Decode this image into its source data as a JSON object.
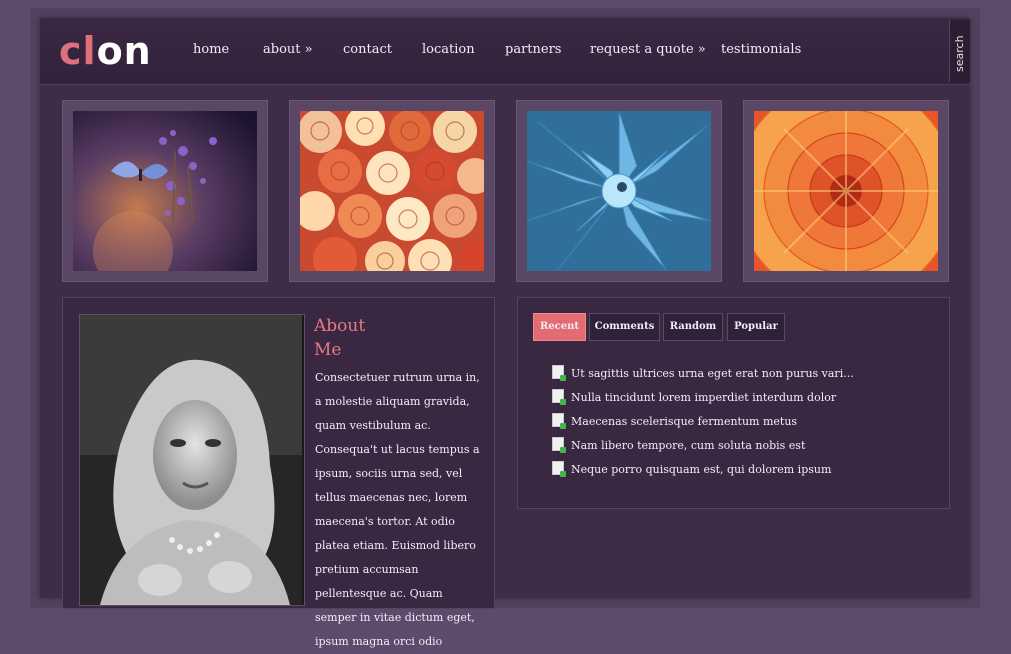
{
  "logo": {
    "part1": "cl",
    "part2": "on"
  },
  "nav": {
    "items": [
      {
        "label": "home"
      },
      {
        "label": "about »"
      },
      {
        "label": "contact"
      },
      {
        "label": "location"
      },
      {
        "label": "partners"
      },
      {
        "label": "request a quote »"
      },
      {
        "label": "testimonials"
      }
    ],
    "search": "search"
  },
  "gallery": [
    {
      "name": "butterfly-lavender"
    },
    {
      "name": "roses"
    },
    {
      "name": "blue-agave"
    },
    {
      "name": "orange-dahlia"
    }
  ],
  "about": {
    "title_line1": "About",
    "title_line2": "Me",
    "text": "Consectetuer rutrum urna in, a molestie aliquam gravida, quam vestibulum ac. Consequa't ut lacus tempus a ipsum, sociis urna sed, vel tellus maecenas nec, lorem maecena's tortor. At odio platea etiam. Euismod libero pretium accumsan pellentesque ac. Quam semper in vitae dictum eget, ipsum magna orci odio"
  },
  "tabs": [
    {
      "label": "Recent"
    },
    {
      "label": "Comments"
    },
    {
      "label": "Random"
    },
    {
      "label": "Popular"
    }
  ],
  "posts": [
    {
      "title": "Ut sagittis ultrices urna eget erat non purus vari..."
    },
    {
      "title": "Nulla tincidunt lorem imperdiet interdum dolor"
    },
    {
      "title": "Maecenas scelerisque fermentum metus"
    },
    {
      "title": "Nam libero tempore, cum soluta nobis est"
    },
    {
      "title": "Neque porro quisquam est, qui dolorem ipsum"
    }
  ],
  "colors": {
    "accent": "#e36b72",
    "background": "#5e4b6b",
    "panel": "#3a2843"
  }
}
